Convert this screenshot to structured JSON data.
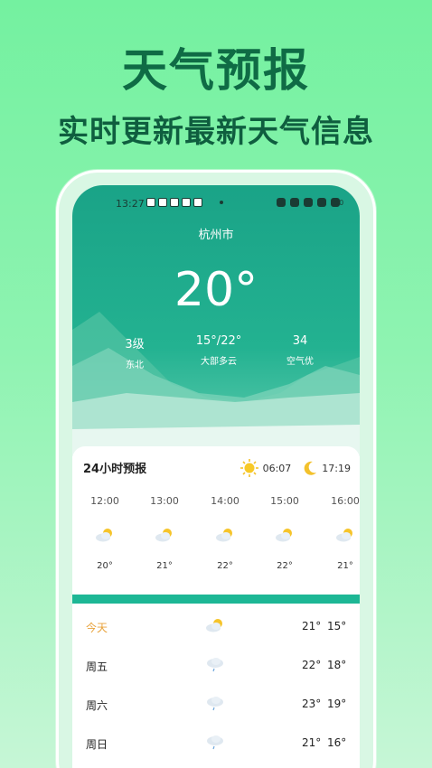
{
  "promo": {
    "title": "天气预报",
    "subtitle": "实时更新最新天气信息"
  },
  "status_bar": {
    "time": "13:27",
    "battery": "50"
  },
  "hero": {
    "city": "杭州市",
    "temperature": "20°",
    "stats": [
      {
        "value": "3级",
        "label": "东北"
      },
      {
        "value": "15°/22°",
        "label": "大部多云"
      },
      {
        "value": "34",
        "label": "空气优"
      }
    ]
  },
  "hourly": {
    "title": "24小时预报",
    "sunrise": "06:07",
    "sunset": "17:19",
    "hours": [
      {
        "time": "12:00",
        "temp": "20°",
        "icon": "partly-cloudy-icon"
      },
      {
        "time": "13:00",
        "temp": "21°",
        "icon": "partly-cloudy-icon"
      },
      {
        "time": "14:00",
        "temp": "22°",
        "icon": "partly-cloudy-icon"
      },
      {
        "time": "15:00",
        "temp": "22°",
        "icon": "partly-cloudy-icon"
      },
      {
        "time": "16:00",
        "temp": "21°",
        "icon": "partly-cloudy-icon"
      }
    ]
  },
  "daily": [
    {
      "day": "今天",
      "hi": "21°",
      "lo": "15°",
      "icon": "partly-cloudy-icon"
    },
    {
      "day": "周五",
      "hi": "22°",
      "lo": "18°",
      "icon": "light-rain-icon"
    },
    {
      "day": "周六",
      "hi": "23°",
      "lo": "19°",
      "icon": "light-rain-icon"
    },
    {
      "day": "周日",
      "hi": "21°",
      "lo": "16°",
      "icon": "light-rain-icon"
    }
  ],
  "colors": {
    "accent": "#1db795",
    "title": "#0f6b45",
    "today": "#e8a23a"
  }
}
